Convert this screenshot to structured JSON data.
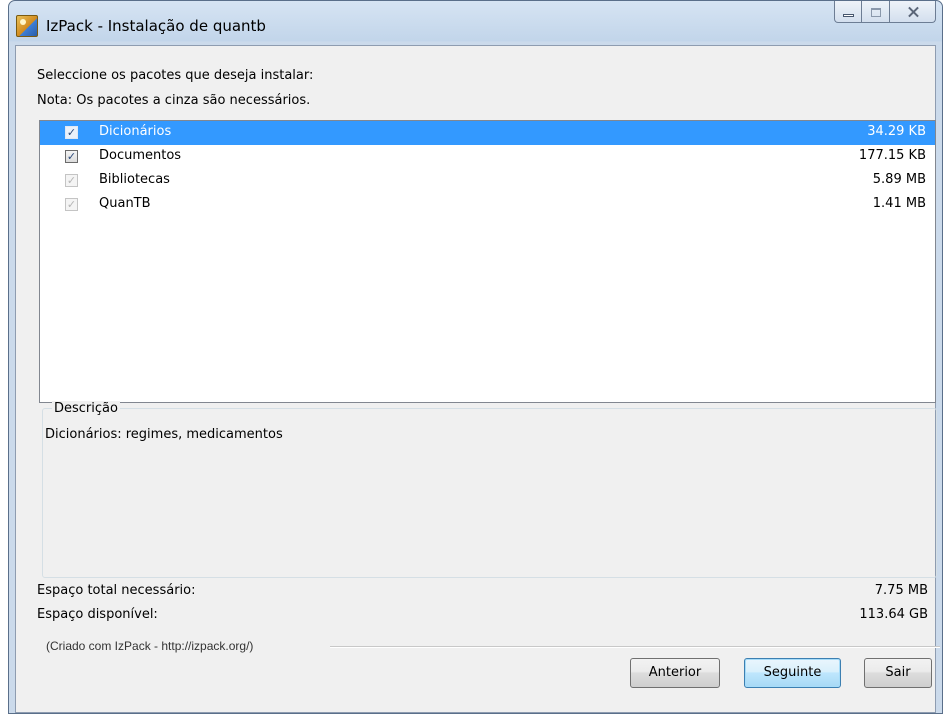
{
  "window": {
    "title": "IzPack - Instalação de quantb",
    "icon": "izpack-app-icon",
    "controls": [
      "minimize-icon",
      "maximize-icon",
      "close-icon"
    ]
  },
  "instructions": {
    "line1": "Seleccione os pacotes que deseja instalar:",
    "line2": "Nota: Os pacotes a cinza são necessários."
  },
  "packages": [
    {
      "name": "Dicionários",
      "size": "34.29 KB",
      "checked": true,
      "required": false,
      "selected": true
    },
    {
      "name": "Documentos",
      "size": "177.15 KB",
      "checked": true,
      "required": false,
      "selected": false
    },
    {
      "name": "Bibliotecas",
      "size": "5.89 MB",
      "checked": true,
      "required": true,
      "selected": false
    },
    {
      "name": "QuanTB",
      "size": "1.41 MB",
      "checked": true,
      "required": true,
      "selected": false
    }
  ],
  "description": {
    "legend": "Descrição",
    "text": "Dicionários: regimes, medicamentos"
  },
  "space": {
    "total_label": "Espaço total necessário:",
    "total_value": "7.75 MB",
    "available_label": "Espaço disponível:",
    "available_value": "113.64 GB"
  },
  "footer": {
    "credit": "(Criado com IzPack - http://izpack.org/)",
    "previous_label": "Anterior",
    "next_label": "Seguinte",
    "quit_label": "Sair"
  },
  "colors": {
    "selection": "#3399ff",
    "titlebar": "#c8d8ea"
  }
}
